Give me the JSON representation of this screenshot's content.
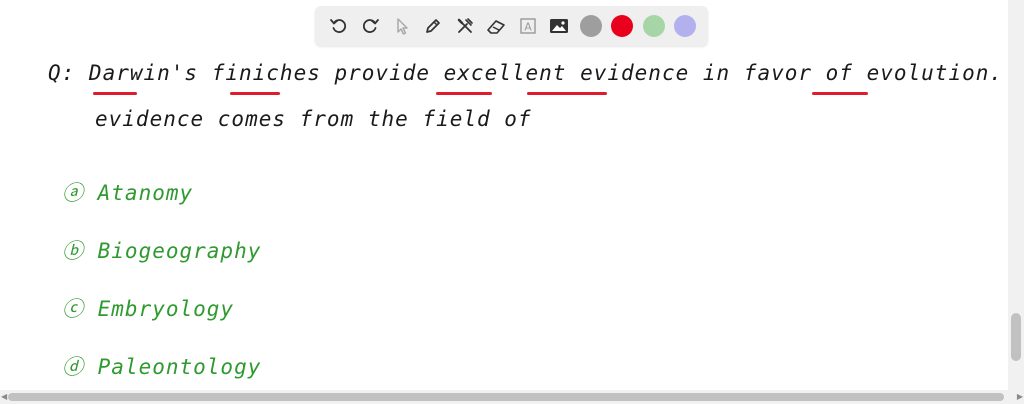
{
  "toolbar": {
    "tools": [
      {
        "name": "undo-icon"
      },
      {
        "name": "redo-icon"
      },
      {
        "name": "pointer-icon"
      },
      {
        "name": "pen-icon"
      },
      {
        "name": "tools-icon"
      },
      {
        "name": "eraser-icon"
      },
      {
        "name": "text-icon",
        "glyph": "A"
      },
      {
        "name": "image-icon"
      }
    ],
    "colors": [
      {
        "name": "color-gray",
        "hex": "#9e9e9e"
      },
      {
        "name": "color-red",
        "hex": "#e8001c"
      },
      {
        "name": "color-green",
        "hex": "#a6d6a6"
      },
      {
        "name": "color-purple",
        "hex": "#b3b0ee"
      }
    ]
  },
  "question": {
    "line1": "Q: Darwin's finiches provide excellent evidence in favor of evolution. This",
    "line2": "evidence comes from the field of"
  },
  "options": [
    "ⓐ Atanomy",
    "ⓑ Biogeography",
    "ⓒ Embryology",
    "ⓓ Paleontology"
  ],
  "colors": {
    "ink": "#1a1a1a",
    "answer_ink": "#2f9a2f",
    "underline": "#e01b2b"
  }
}
